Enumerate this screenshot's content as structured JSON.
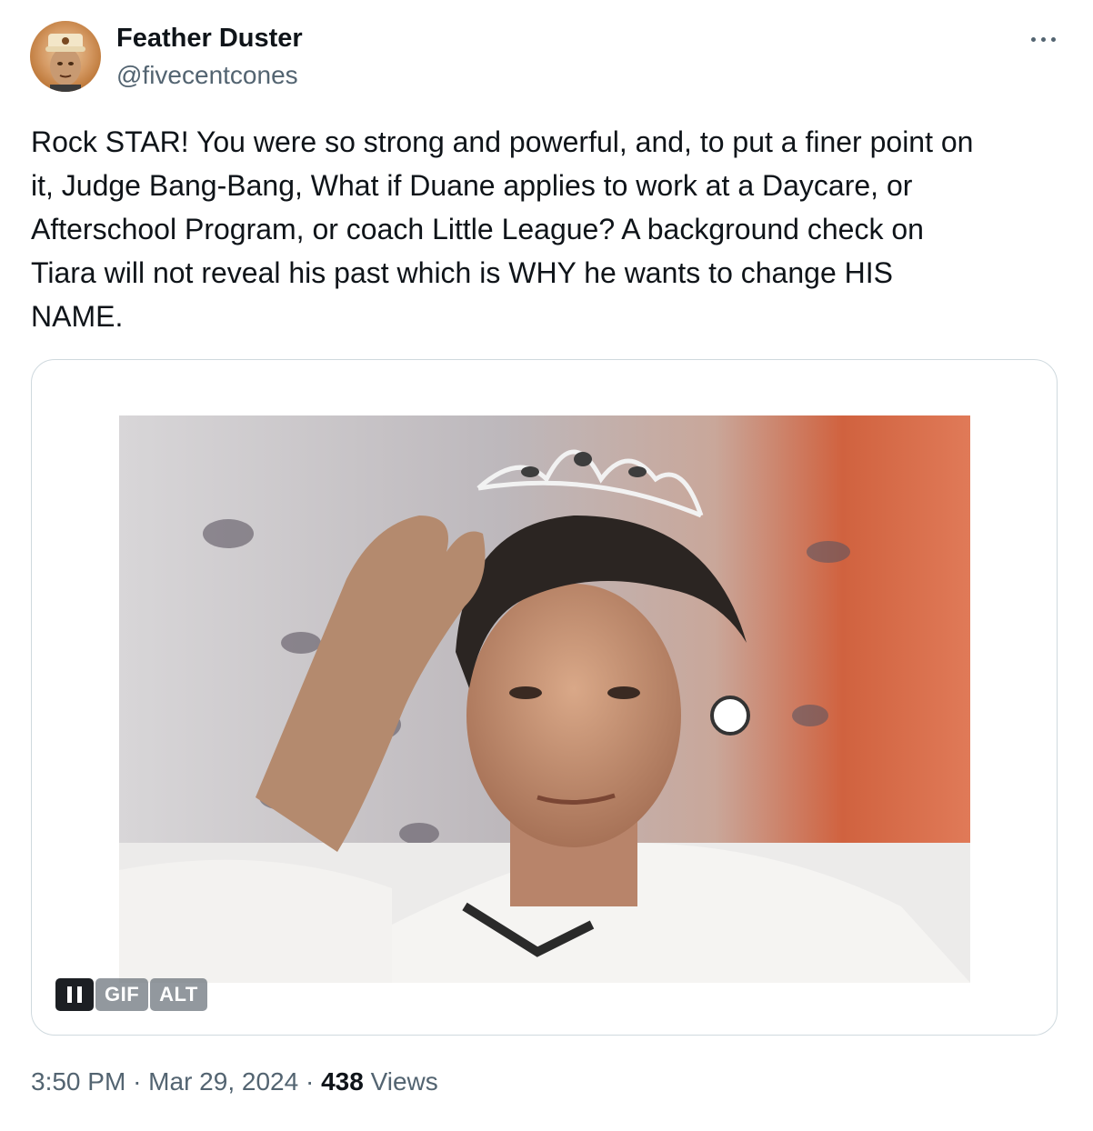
{
  "author": {
    "name": "Feather Duster",
    "handle": "@fivecentcones"
  },
  "more_icon": "ellipsis-icon",
  "tweet": {
    "text": "Rock STAR! You were so strong and powerful, and, to put a finer point on\nit, Judge Bang-Bang, What if Duane applies to work at a Daycare, or\nAfterschool Program, or coach Little League? A background check on\nTiara will not reveal his past which is WHY he wants to change HIS\nNAME."
  },
  "media": {
    "type": "gif",
    "pause_icon": "pause-icon",
    "gif_label": "GIF",
    "alt_label": "ALT"
  },
  "meta": {
    "time": "3:50 PM",
    "date": "Mar 29, 2024",
    "separator": "·",
    "views_count": "438",
    "views_label": "Views"
  },
  "colors": {
    "text_primary": "#0f1419",
    "text_secondary": "#536471",
    "border": "#cfd9de"
  }
}
